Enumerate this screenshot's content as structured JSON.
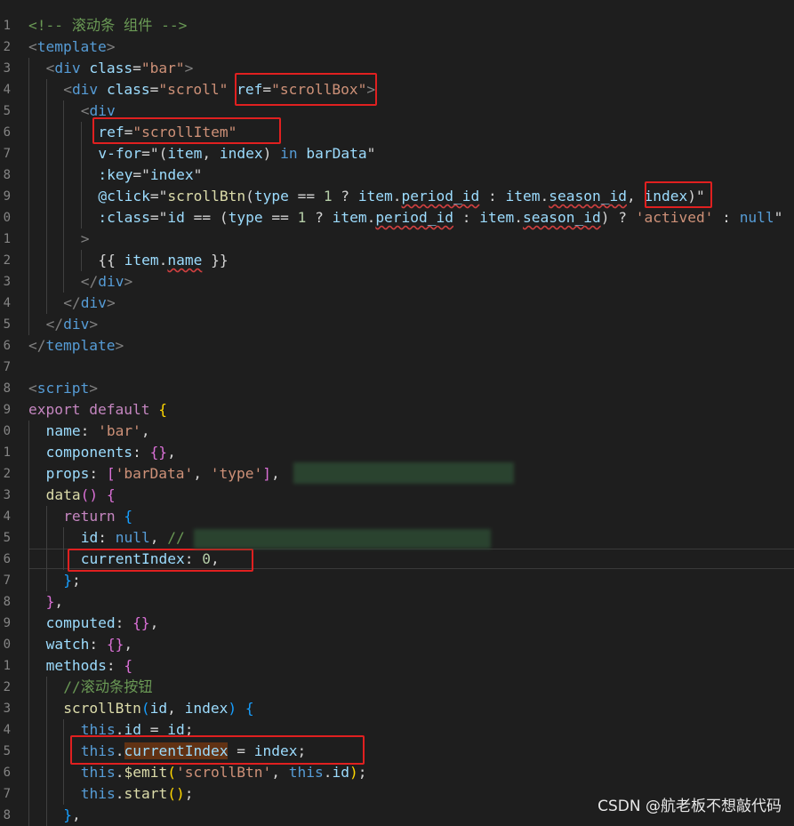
{
  "editor": {
    "lines": [
      {
        "n": "1",
        "indent": 0,
        "tokens": [
          [
            "<!-- 滚动条 组件 -->",
            "t-comment"
          ]
        ]
      },
      {
        "n": "2",
        "indent": 0,
        "tokens": [
          [
            "<",
            "t-punct"
          ],
          [
            "template",
            "t-tag"
          ],
          [
            ">",
            "t-punct"
          ]
        ]
      },
      {
        "n": "3",
        "indent": 1,
        "tokens": [
          [
            "<",
            "t-punct"
          ],
          [
            "div",
            "t-tag"
          ],
          [
            " ",
            "t-def"
          ],
          [
            "class",
            "t-attr"
          ],
          [
            "=",
            "t-op"
          ],
          [
            "\"bar\"",
            "t-str"
          ],
          [
            ">",
            "t-punct"
          ]
        ]
      },
      {
        "n": "4",
        "indent": 2,
        "tokens": [
          [
            "<",
            "t-punct"
          ],
          [
            "div",
            "t-tag"
          ],
          [
            " ",
            "t-def"
          ],
          [
            "class",
            "t-attr"
          ],
          [
            "=",
            "t-op"
          ],
          [
            "\"scroll\"",
            "t-str"
          ],
          [
            " ",
            "t-def"
          ],
          [
            "ref",
            "t-attr"
          ],
          [
            "=",
            "t-op"
          ],
          [
            "\"scrollBox\"",
            "t-str"
          ],
          [
            ">",
            "t-punct"
          ]
        ]
      },
      {
        "n": "5",
        "indent": 3,
        "tokens": [
          [
            "<",
            "t-punct"
          ],
          [
            "div",
            "t-tag"
          ]
        ]
      },
      {
        "n": "6",
        "indent": 4,
        "tokens": [
          [
            "ref",
            "t-attr"
          ],
          [
            "=",
            "t-op"
          ],
          [
            "\"scrollItem\"",
            "t-str"
          ]
        ]
      },
      {
        "n": "7",
        "indent": 4,
        "tokens": [
          [
            "v-for",
            "t-attr"
          ],
          [
            "=\"(",
            "t-op"
          ],
          [
            "item",
            "t-var"
          ],
          [
            ", ",
            "t-def"
          ],
          [
            "index",
            "t-var"
          ],
          [
            ") ",
            "t-def"
          ],
          [
            "in",
            "t-const"
          ],
          [
            " ",
            "t-def"
          ],
          [
            "barData",
            "t-var"
          ],
          [
            "\"",
            "t-op"
          ]
        ]
      },
      {
        "n": "8",
        "indent": 4,
        "tokens": [
          [
            ":key",
            "t-attr"
          ],
          [
            "=\"",
            "t-op"
          ],
          [
            "index",
            "t-var"
          ],
          [
            "\"",
            "t-op"
          ]
        ]
      },
      {
        "n": "9",
        "indent": 4,
        "tokens": [
          [
            "@click",
            "t-attr"
          ],
          [
            "=\"",
            "t-op"
          ],
          [
            "scrollBtn",
            "t-fn"
          ],
          [
            "(",
            "t-def"
          ],
          [
            "type",
            "t-var"
          ],
          [
            " == ",
            "t-def"
          ],
          [
            "1",
            "t-num"
          ],
          [
            " ? ",
            "t-def"
          ],
          [
            "item",
            "t-var"
          ],
          [
            ".",
            "t-def"
          ],
          [
            "period_id",
            "t-var wavy"
          ],
          [
            " : ",
            "t-def"
          ],
          [
            "item",
            "t-var"
          ],
          [
            ".",
            "t-def"
          ],
          [
            "season_id",
            "t-var wavy"
          ],
          [
            ", ",
            "t-def"
          ],
          [
            "index",
            "t-var"
          ],
          [
            ")\"",
            "t-op"
          ]
        ]
      },
      {
        "n": "0",
        "indent": 4,
        "tokens": [
          [
            ":class",
            "t-attr"
          ],
          [
            "=\"",
            "t-op"
          ],
          [
            "id",
            "t-var"
          ],
          [
            " == (",
            "t-def"
          ],
          [
            "type",
            "t-var"
          ],
          [
            " == ",
            "t-def"
          ],
          [
            "1",
            "t-num"
          ],
          [
            " ? ",
            "t-def"
          ],
          [
            "item",
            "t-var"
          ],
          [
            ".",
            "t-def"
          ],
          [
            "period_id",
            "t-var wavy"
          ],
          [
            " : ",
            "t-def"
          ],
          [
            "item",
            "t-var"
          ],
          [
            ".",
            "t-def"
          ],
          [
            "season_id",
            "t-var wavy"
          ],
          [
            ") ? ",
            "t-def"
          ],
          [
            "'actived'",
            "t-str"
          ],
          [
            " : ",
            "t-def"
          ],
          [
            "null",
            "t-const"
          ],
          [
            "\"",
            "t-op"
          ]
        ]
      },
      {
        "n": "1",
        "indent": 3,
        "tokens": [
          [
            ">",
            "t-punct"
          ]
        ]
      },
      {
        "n": "2",
        "indent": 4,
        "tokens": [
          [
            "{{ ",
            "t-def"
          ],
          [
            "item",
            "t-var"
          ],
          [
            ".",
            "t-def"
          ],
          [
            "name",
            "t-var wavy"
          ],
          [
            " }}",
            "t-def"
          ]
        ]
      },
      {
        "n": "3",
        "indent": 3,
        "tokens": [
          [
            "</",
            "t-punct"
          ],
          [
            "div",
            "t-tag"
          ],
          [
            ">",
            "t-punct"
          ]
        ]
      },
      {
        "n": "4",
        "indent": 2,
        "tokens": [
          [
            "</",
            "t-punct"
          ],
          [
            "div",
            "t-tag"
          ],
          [
            ">",
            "t-punct"
          ]
        ]
      },
      {
        "n": "5",
        "indent": 1,
        "tokens": [
          [
            "</",
            "t-punct"
          ],
          [
            "div",
            "t-tag"
          ],
          [
            ">",
            "t-punct"
          ]
        ]
      },
      {
        "n": "6",
        "indent": 0,
        "tokens": [
          [
            "</",
            "t-punct"
          ],
          [
            "template",
            "t-tag"
          ],
          [
            ">",
            "t-punct"
          ]
        ]
      },
      {
        "n": "7",
        "indent": 0,
        "tokens": []
      },
      {
        "n": "8",
        "indent": 0,
        "tokens": [
          [
            "<",
            "t-punct"
          ],
          [
            "script",
            "t-tag"
          ],
          [
            ">",
            "t-punct"
          ]
        ]
      },
      {
        "n": "9",
        "indent": 0,
        "tokens": [
          [
            "export",
            "t-kw"
          ],
          [
            " ",
            "t-def"
          ],
          [
            "default",
            "t-kw"
          ],
          [
            " ",
            "t-def"
          ],
          [
            "{",
            "t-br1"
          ]
        ]
      },
      {
        "n": "0",
        "indent": 1,
        "tokens": [
          [
            "name",
            "t-var"
          ],
          [
            ": ",
            "t-def"
          ],
          [
            "'bar'",
            "t-str"
          ],
          [
            ",",
            "t-def"
          ]
        ]
      },
      {
        "n": "1",
        "indent": 1,
        "tokens": [
          [
            "components",
            "t-var"
          ],
          [
            ": ",
            "t-def"
          ],
          [
            "{}",
            "t-br2"
          ],
          [
            ",",
            "t-def"
          ]
        ]
      },
      {
        "n": "2",
        "indent": 1,
        "tokens": [
          [
            "props",
            "t-var"
          ],
          [
            ": ",
            "t-def"
          ],
          [
            "[",
            "t-br2"
          ],
          [
            "'barData'",
            "t-str"
          ],
          [
            ", ",
            "t-def"
          ],
          [
            "'type'",
            "t-str"
          ],
          [
            "]",
            "t-br2"
          ],
          [
            ",",
            "t-def"
          ]
        ]
      },
      {
        "n": "3",
        "indent": 1,
        "tokens": [
          [
            "data",
            "t-fn"
          ],
          [
            "() ",
            "t-br2"
          ],
          [
            "{",
            "t-br2"
          ]
        ]
      },
      {
        "n": "4",
        "indent": 2,
        "tokens": [
          [
            "return",
            "t-kw"
          ],
          [
            " ",
            "t-def"
          ],
          [
            "{",
            "t-br3"
          ]
        ]
      },
      {
        "n": "5",
        "indent": 3,
        "tokens": [
          [
            "id",
            "t-var"
          ],
          [
            ": ",
            "t-def"
          ],
          [
            "null",
            "t-const"
          ],
          [
            ", ",
            "t-def"
          ],
          [
            "//",
            "t-comment"
          ]
        ]
      },
      {
        "n": "6",
        "indent": 3,
        "tokens": [
          [
            "currentIndex",
            "t-var"
          ],
          [
            ": ",
            "t-def"
          ],
          [
            "0",
            "t-num"
          ],
          [
            ",",
            "t-def"
          ]
        ]
      },
      {
        "n": "7",
        "indent": 2,
        "tokens": [
          [
            "}",
            "t-br3"
          ],
          [
            ";",
            "t-def"
          ]
        ]
      },
      {
        "n": "8",
        "indent": 1,
        "tokens": [
          [
            "}",
            "t-br2"
          ],
          [
            ",",
            "t-def"
          ]
        ]
      },
      {
        "n": "9",
        "indent": 1,
        "tokens": [
          [
            "computed",
            "t-var"
          ],
          [
            ": ",
            "t-def"
          ],
          [
            "{}",
            "t-br2"
          ],
          [
            ",",
            "t-def"
          ]
        ]
      },
      {
        "n": "0",
        "indent": 1,
        "tokens": [
          [
            "watch",
            "t-var"
          ],
          [
            ": ",
            "t-def"
          ],
          [
            "{}",
            "t-br2"
          ],
          [
            ",",
            "t-def"
          ]
        ]
      },
      {
        "n": "1",
        "indent": 1,
        "tokens": [
          [
            "methods",
            "t-var"
          ],
          [
            ": ",
            "t-def"
          ],
          [
            "{",
            "t-br2"
          ]
        ]
      },
      {
        "n": "2",
        "indent": 2,
        "tokens": [
          [
            "//滚动条按钮",
            "t-comment"
          ]
        ]
      },
      {
        "n": "3",
        "indent": 2,
        "tokens": [
          [
            "scrollBtn",
            "t-fn"
          ],
          [
            "(",
            "t-br3"
          ],
          [
            "id",
            "t-var"
          ],
          [
            ", ",
            "t-def"
          ],
          [
            "index",
            "t-var"
          ],
          [
            ") ",
            "t-br3"
          ],
          [
            "{",
            "t-br3"
          ]
        ]
      },
      {
        "n": "4",
        "indent": 3,
        "tokens": [
          [
            "this",
            "t-const"
          ],
          [
            ".",
            "t-def"
          ],
          [
            "id",
            "t-var"
          ],
          [
            " = ",
            "t-def"
          ],
          [
            "id",
            "t-var"
          ],
          [
            ";",
            "t-def"
          ]
        ]
      },
      {
        "n": "5",
        "indent": 3,
        "tokens": [
          [
            "this",
            "t-const"
          ],
          [
            ".",
            "t-def"
          ],
          [
            "currentIndex",
            "t-var sel-bg"
          ],
          [
            " = ",
            "t-def"
          ],
          [
            "index",
            "t-var"
          ],
          [
            ";",
            "t-def"
          ]
        ]
      },
      {
        "n": "6",
        "indent": 3,
        "tokens": [
          [
            "this",
            "t-const"
          ],
          [
            ".",
            "t-def"
          ],
          [
            "$emit",
            "t-fn"
          ],
          [
            "(",
            "t-br1"
          ],
          [
            "'scrollBtn'",
            "t-str"
          ],
          [
            ", ",
            "t-def"
          ],
          [
            "this",
            "t-const"
          ],
          [
            ".",
            "t-def"
          ],
          [
            "id",
            "t-var"
          ],
          [
            ")",
            "t-br1"
          ],
          [
            ";",
            "t-def"
          ]
        ]
      },
      {
        "n": "7",
        "indent": 3,
        "tokens": [
          [
            "this",
            "t-const"
          ],
          [
            ".",
            "t-def"
          ],
          [
            "start",
            "t-fn"
          ],
          [
            "()",
            "t-br1"
          ],
          [
            ";",
            "t-def"
          ]
        ]
      },
      {
        "n": "8",
        "indent": 2,
        "tokens": [
          [
            "}",
            "t-br3"
          ],
          [
            ",",
            "t-def"
          ]
        ]
      }
    ]
  },
  "watermark": "CSDN @航老板不想敲代码"
}
